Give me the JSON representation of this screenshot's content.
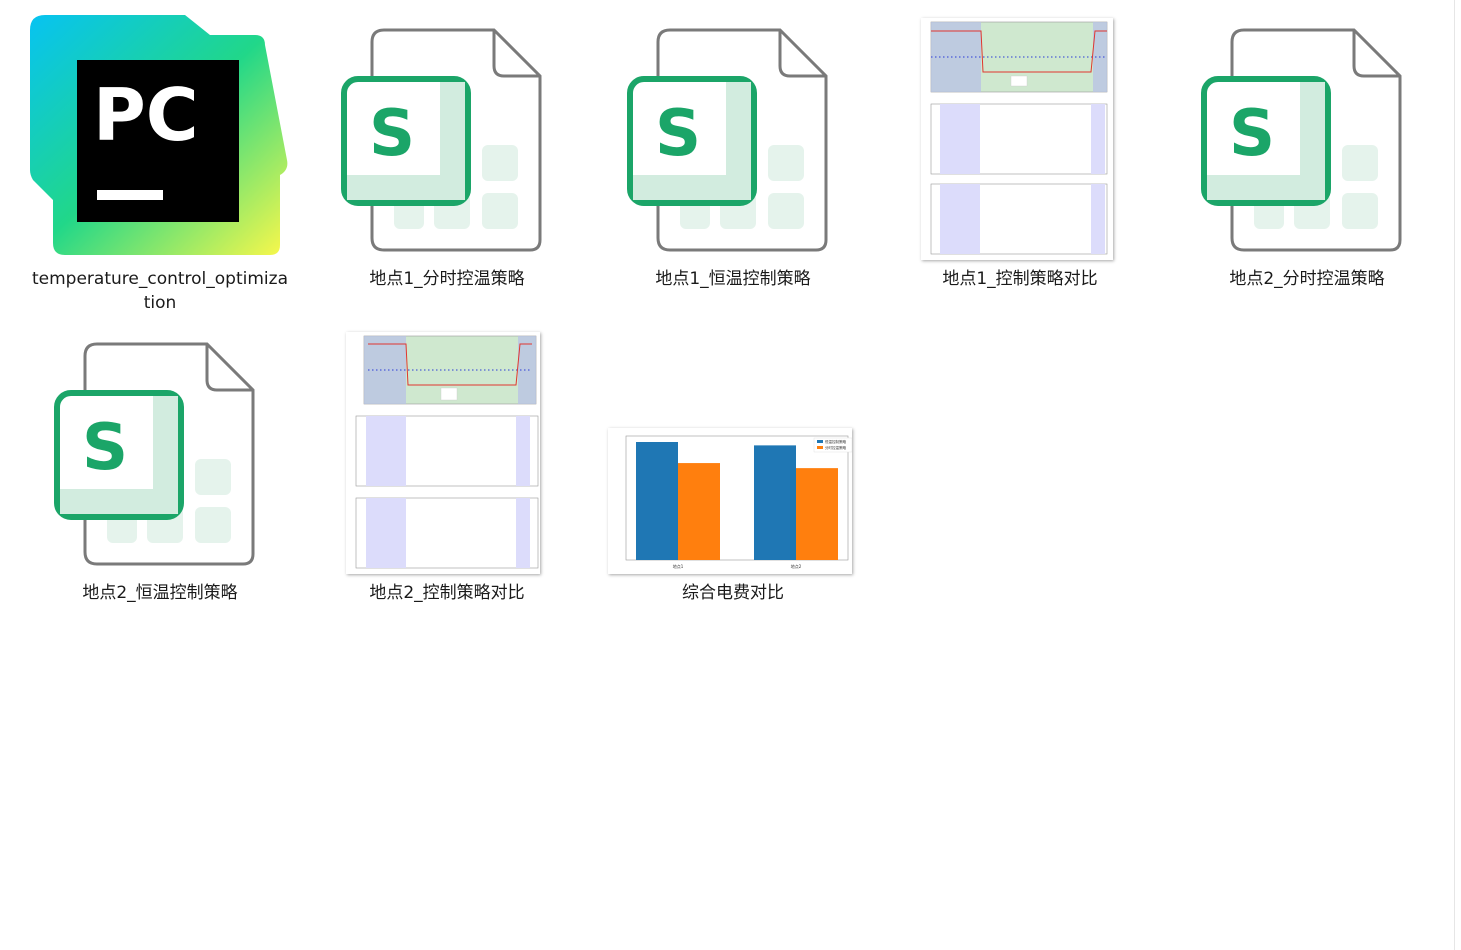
{
  "files": [
    {
      "name": "temperature_control_optimization",
      "type": "pycharm-project",
      "icon": "pycharm-icon"
    },
    {
      "name": "地点1_分时控温策略",
      "type": "spreadsheet",
      "icon": "wps-sheet-icon",
      "icon_letter": "S"
    },
    {
      "name": "地点1_恒温控制策略",
      "type": "spreadsheet",
      "icon": "wps-sheet-icon",
      "icon_letter": "S"
    },
    {
      "name": "地点1_控制策略对比",
      "type": "image",
      "icon": "chart-thumbnail"
    },
    {
      "name": "地点2_分时控温策略",
      "type": "spreadsheet",
      "icon": "wps-sheet-icon",
      "icon_letter": "S"
    },
    {
      "name": "地点2_恒温控制策略",
      "type": "spreadsheet",
      "icon": "wps-sheet-icon",
      "icon_letter": "S"
    },
    {
      "name": "地点2_控制策略对比",
      "type": "image",
      "icon": "chart-thumbnail"
    },
    {
      "name": "综合电费对比",
      "type": "image",
      "icon": "chart-thumbnail"
    }
  ],
  "pycharm": {
    "letters": "PC"
  },
  "colors": {
    "sheet_green": "#1ba568",
    "series_blue": "#1f77b4",
    "series_orange": "#ff7f0e",
    "line_blue": "#2b3bd6",
    "line_red": "#e0362f"
  },
  "chart_data": [
    {
      "type": "bar",
      "categories": [
        "地点1",
        "地点2"
      ],
      "series": [
        {
          "name": "恒温控制策略",
          "values": [
            141000,
            136000
          ]
        },
        {
          "name": "分时控温策略",
          "values": [
            115000,
            109000
          ]
        }
      ],
      "ylim": [
        0,
        140000
      ]
    }
  ]
}
